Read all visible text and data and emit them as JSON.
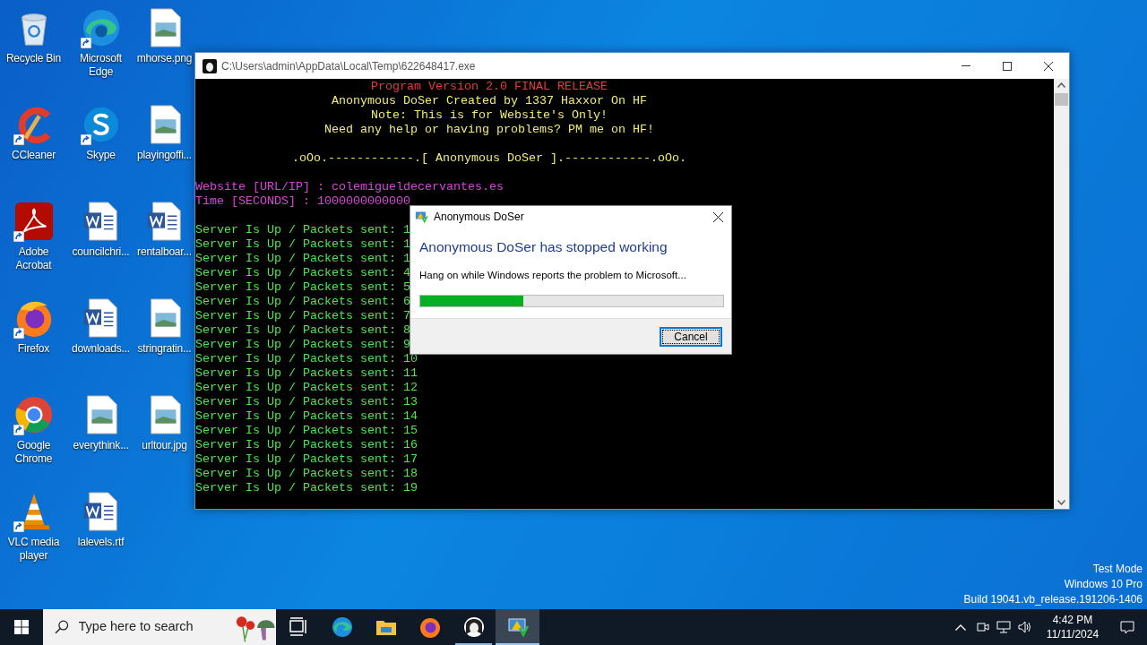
{
  "desktop": {
    "icons": [
      {
        "label": "Recycle Bin",
        "kind": "recycle",
        "shortcut": false
      },
      {
        "label": "CCleaner",
        "kind": "ccleaner",
        "shortcut": true
      },
      {
        "label": "Adobe Acrobat",
        "kind": "acrobat",
        "shortcut": true
      },
      {
        "label": "Firefox",
        "kind": "firefox",
        "shortcut": true
      },
      {
        "label": "Google Chrome",
        "kind": "chrome",
        "shortcut": true
      },
      {
        "label": "VLC media player",
        "kind": "vlc",
        "shortcut": true
      },
      {
        "label": "Microsoft Edge",
        "kind": "edge",
        "shortcut": true
      },
      {
        "label": "Skype",
        "kind": "skype",
        "shortcut": true
      },
      {
        "label": "councilchri...",
        "kind": "word",
        "shortcut": false
      },
      {
        "label": "downloads...",
        "kind": "word",
        "shortcut": false
      },
      {
        "label": "everythink...",
        "kind": "image",
        "shortcut": false
      },
      {
        "label": "lalevels.rtf",
        "kind": "word",
        "shortcut": false
      },
      {
        "label": "mhorse.png",
        "kind": "image",
        "shortcut": false
      },
      {
        "label": "playingoffi...",
        "kind": "image",
        "shortcut": false
      },
      {
        "label": "rentalboar...",
        "kind": "word",
        "shortcut": false
      },
      {
        "label": "stringratin...",
        "kind": "image",
        "shortcut": false
      },
      {
        "label": "urltour.jpg",
        "kind": "image",
        "shortcut": false
      }
    ],
    "watermark": [
      "Test Mode",
      "Windows 10 Pro",
      "Build 19041.vb_release.191206-1406"
    ]
  },
  "console_window": {
    "title": "C:\\Users\\admin\\AppData\\Local\\Temp\\622648417.exe",
    "lines": [
      {
        "kind": "centered",
        "text": "Program Version 2.0 FINAL RELEASE",
        "color": "#e83a3a"
      },
      {
        "kind": "centered",
        "text": "Anonymous DoSer Created by 1337 Haxxor On HF",
        "color": "#f2ee6a"
      },
      {
        "kind": "centered",
        "text": "Note: This is for Website's Only!",
        "color": "#f2ee6a"
      },
      {
        "kind": "centered",
        "text": "Need any help or having problems? PM me on HF!",
        "color": "#f2ee6a"
      },
      {
        "kind": "blank"
      },
      {
        "kind": "centered",
        "text": ".oOo.------------.[ Anonymous DoSer ].------------.oOo.",
        "color": "#f2ee6a"
      },
      {
        "kind": "blank"
      },
      {
        "kind": "left",
        "text": "Website [URL/IP] : colemigueldecervantes.es",
        "color": "#d846d8"
      },
      {
        "kind": "left",
        "text": "Time [SECONDS] : 1000000000000",
        "color": "#d846d8"
      },
      {
        "kind": "blank"
      },
      {
        "kind": "left",
        "text": "Server Is Up / Packets sent: 1",
        "color": "#4ee84e"
      },
      {
        "kind": "left",
        "text": "Server Is Up / Packets sent: 1",
        "color": "#4ee84e"
      },
      {
        "kind": "left",
        "text": "Server Is Up / Packets sent: 1",
        "color": "#4ee84e"
      },
      {
        "kind": "left",
        "text": "Server Is Up / Packets sent: 4",
        "color": "#4ee84e"
      },
      {
        "kind": "left",
        "text": "Server Is Up / Packets sent: 5",
        "color": "#4ee84e"
      },
      {
        "kind": "left",
        "text": "Server Is Up / Packets sent: 6",
        "color": "#4ee84e"
      },
      {
        "kind": "left",
        "text": "Server Is Up / Packets sent: 7",
        "color": "#4ee84e"
      },
      {
        "kind": "left",
        "text": "Server Is Up / Packets sent: 8",
        "color": "#4ee84e"
      },
      {
        "kind": "left",
        "text": "Server Is Up / Packets sent: 9",
        "color": "#4ee84e"
      },
      {
        "kind": "left",
        "text": "Server Is Up / Packets sent: 10",
        "color": "#4ee84e"
      },
      {
        "kind": "left",
        "text": "Server Is Up / Packets sent: 11",
        "color": "#4ee84e"
      },
      {
        "kind": "left",
        "text": "Server Is Up / Packets sent: 12",
        "color": "#4ee84e"
      },
      {
        "kind": "left",
        "text": "Server Is Up / Packets sent: 13",
        "color": "#4ee84e"
      },
      {
        "kind": "left",
        "text": "Server Is Up / Packets sent: 14",
        "color": "#4ee84e"
      },
      {
        "kind": "left",
        "text": "Server Is Up / Packets sent: 15",
        "color": "#4ee84e"
      },
      {
        "kind": "left",
        "text": "Server Is Up / Packets sent: 16",
        "color": "#4ee84e"
      },
      {
        "kind": "left",
        "text": "Server Is Up / Packets sent: 17",
        "color": "#4ee84e"
      },
      {
        "kind": "left",
        "text": "Server Is Up / Packets sent: 18",
        "color": "#4ee84e"
      },
      {
        "kind": "left",
        "text": "Server Is Up / Packets sent: 19",
        "color": "#4ee84e"
      }
    ]
  },
  "error_dialog": {
    "title": "Anonymous DoSer",
    "heading": "Anonymous DoSer has stopped working",
    "message": "Hang on while Windows reports the problem to Microsoft...",
    "progress": {
      "level": 0.34
    },
    "buttons": [
      {
        "label": "Cancel",
        "focused": true
      }
    ]
  },
  "taskbar": {
    "search": {
      "placeholder": "Type here to search"
    },
    "apps": [
      {
        "kind": "taskview",
        "running": false,
        "selected": false
      },
      {
        "kind": "edge",
        "running": false,
        "selected": false
      },
      {
        "kind": "explorer",
        "running": false,
        "selected": false
      },
      {
        "kind": "firefox",
        "running": false,
        "selected": false
      },
      {
        "kind": "anonymous",
        "running": true,
        "selected": false
      },
      {
        "kind": "werfault",
        "running": true,
        "selected": true
      }
    ],
    "time": "4:42 PM",
    "date": "11/11/2024"
  }
}
